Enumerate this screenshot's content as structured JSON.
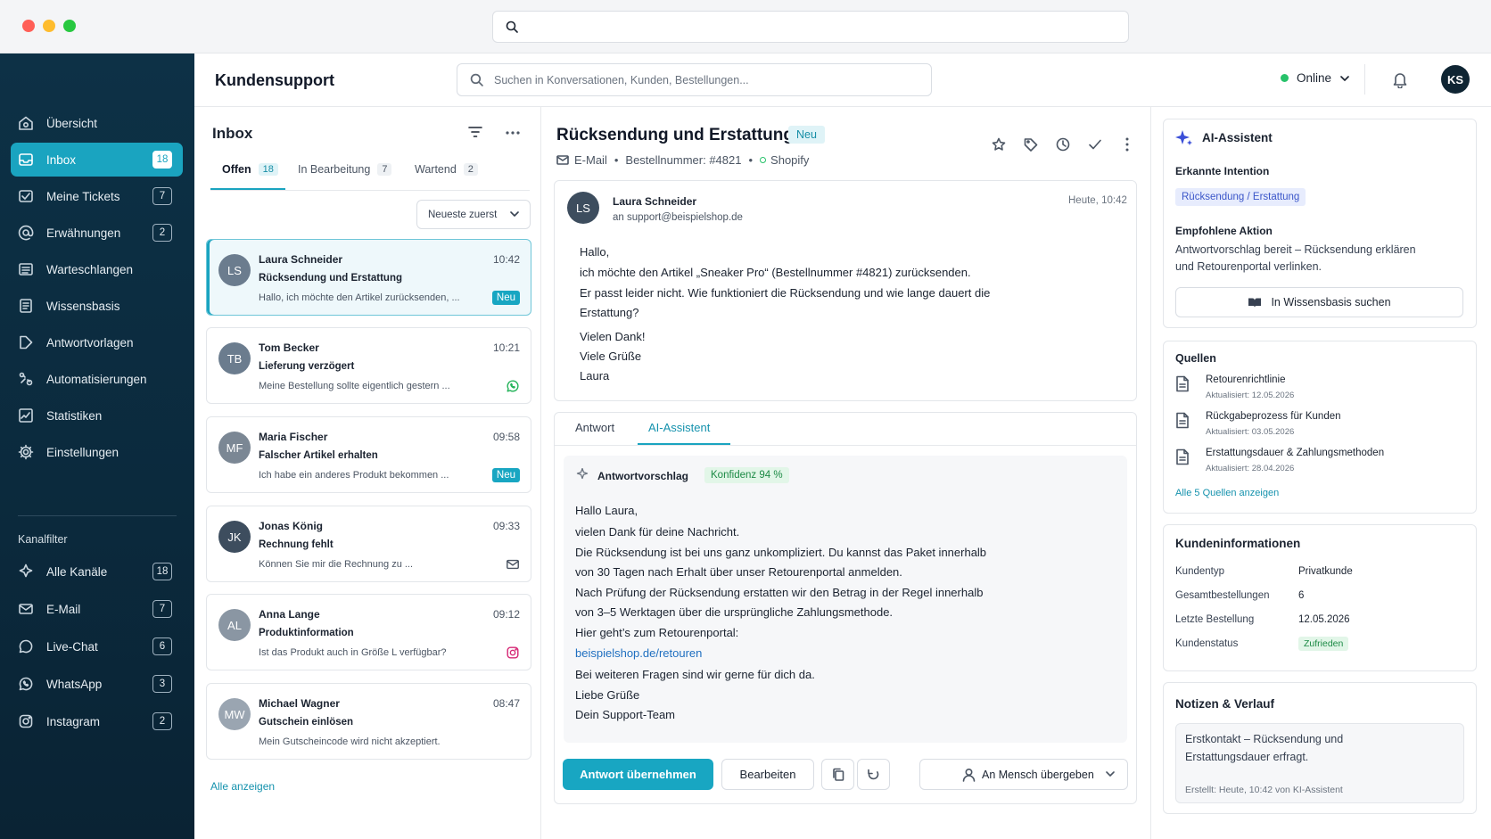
{
  "window": {
    "controls": [
      "close",
      "minimize",
      "maximize"
    ]
  },
  "colors": {
    "accent": "#18a6c2",
    "sidebar": "#0d3146",
    "online": "#27c26a",
    "ai": "#3b4fd8"
  },
  "app": {
    "title": "Kundensupport",
    "search_placeholder": "Suchen in Konversationen, Kunden, Bestellungen...",
    "status": "Online",
    "user_initials": "KS"
  },
  "nav": [
    {
      "label": "Übersicht",
      "icon": "home-icon"
    },
    {
      "label": "Inbox",
      "icon": "inbox-icon",
      "badge": "18",
      "active": true
    },
    {
      "label": "Meine Tickets",
      "icon": "ticket-icon",
      "badge": "7"
    },
    {
      "label": "Erwähnungen",
      "icon": "at-icon",
      "badge": "2"
    },
    {
      "label": "Warteschlangen",
      "icon": "queue-icon"
    },
    {
      "label": "Wissensbasis",
      "icon": "book-icon"
    },
    {
      "label": "Antwortvorlagen",
      "icon": "template-icon"
    },
    {
      "label": "Automatisierungen",
      "icon": "automation-icon"
    },
    {
      "label": "Statistiken",
      "icon": "chart-icon"
    },
    {
      "label": "Einstellungen",
      "icon": "gear-icon"
    }
  ],
  "channel_filter": {
    "heading": "Kanalfilter",
    "items": [
      {
        "label": "Alle Kanäle",
        "icon": "all-channels-icon",
        "badge": "18"
      },
      {
        "label": "E-Mail",
        "icon": "mail-icon",
        "badge": "7"
      },
      {
        "label": "Live-Chat",
        "icon": "chat-icon",
        "badge": "6"
      },
      {
        "label": "WhatsApp",
        "icon": "whatsapp-icon",
        "badge": "3"
      },
      {
        "label": "Instagram",
        "icon": "instagram-icon",
        "badge": "2"
      }
    ]
  },
  "inbox": {
    "title": "Inbox",
    "tabs": [
      {
        "label": "Offen",
        "count": "18"
      },
      {
        "label": "In Bearbeitung",
        "count": "7"
      },
      {
        "label": "Wartend",
        "count": "2"
      }
    ],
    "sort": "Neueste zuerst",
    "show_all": "Alle anzeigen",
    "conversations": [
      {
        "initials": "LS",
        "name": "Laura Schneider",
        "time": "10:42",
        "subject": "Rücksendung und Erstattung",
        "preview": "Hallo, ich möchte den Artikel zurücksenden, ...",
        "badge": "Neu",
        "channel": "",
        "avatar_color": "#6b7c8e"
      },
      {
        "initials": "TB",
        "name": "Tom Becker",
        "time": "10:21",
        "subject": "Lieferung verzögert",
        "preview": "Meine Bestellung sollte eigentlich gestern ...",
        "badge": "",
        "channel": "whatsapp-icon",
        "avatar_color": "#6b7c8e"
      },
      {
        "initials": "MF",
        "name": "Maria Fischer",
        "time": "09:58",
        "subject": "Falscher Artikel erhalten",
        "preview": "Ich habe ein anderes Produkt bekommen ...",
        "badge": "Neu",
        "channel": "",
        "avatar_color": "#7b8794"
      },
      {
        "initials": "JK",
        "name": "Jonas König",
        "time": "09:33",
        "subject": "Rechnung fehlt",
        "preview": "Können Sie mir die Rechnung zu ...",
        "badge": "",
        "channel": "mail-icon",
        "avatar_color": "#3d4d5e"
      },
      {
        "initials": "AL",
        "name": "Anna Lange",
        "time": "09:12",
        "subject": "Produktinformation",
        "preview": "Ist das Produkt auch in Größe L verfügbar?",
        "badge": "",
        "channel": "instagram-icon",
        "avatar_color": "#8a96a3"
      },
      {
        "initials": "MW",
        "name": "Michael Wagner",
        "time": "08:47",
        "subject": "Gutschein einlösen",
        "preview": "Mein Gutscheincode wird nicht akzeptiert.",
        "badge": "",
        "channel": "",
        "avatar_color": "#9aa5b1"
      }
    ]
  },
  "conversation": {
    "title": "Rücksendung und Erstattung",
    "badge": "Neu",
    "channel": "E-Mail",
    "order": "Bestellnummer: #4821",
    "shop": "Shopify",
    "actions": [
      "star-icon",
      "tag-icon",
      "clock-icon",
      "check-icon",
      "more-vertical-icon"
    ],
    "message": {
      "initials": "LS",
      "from": "Laura Schneider",
      "to": "an support@beispielshop.de",
      "time": "Heute, 10:42",
      "lines": [
        "Hallo,",
        "ich möchte den Artikel „Sneaker Pro“ (Bestellnummer #4821) zurücksenden.",
        "Er passt leider nicht. Wie funktioniert die Rücksendung und wie lange dauert die",
        "Erstattung?",
        "Vielen Dank!",
        "Viele Grüße",
        "Laura"
      ]
    },
    "reply_tabs": [
      "Antwort",
      "AI-Assistent"
    ],
    "suggestion": {
      "title": "Antwortvorschlag",
      "confidence": "Konfidenz 94 %",
      "lines": [
        "Hallo Laura,",
        "vielen Dank für deine Nachricht.",
        "Die Rücksendung ist bei uns ganz unkompliziert. Du kannst das Paket innerhalb",
        "von 30 Tagen nach Erhalt über unser Retourenportal anmelden.",
        "Nach Prüfung der Rücksendung erstatten wir den Betrag in der Regel innerhalb",
        "von 3–5 Werktagen über die ursprüngliche Zahlungsmethode.",
        "Hier geht’s zum Retourenportal:",
        "beispielshop.de/retouren",
        "Bei weiteren Fragen sind wir gerne für dich da.",
        "Liebe Grüße",
        "Dein Support-Team"
      ]
    },
    "buttons": {
      "accept": "Antwort übernehmen",
      "edit": "Bearbeiten",
      "handover": "An Mensch übergeben"
    }
  },
  "ai_panel": {
    "title": "AI-Assistent",
    "intent_heading": "Erkannte Intention",
    "intent": "Rücksendung / Erstattung",
    "action_heading": "Empfohlene Aktion",
    "action_line1": "Antwortvorschlag bereit – Rücksendung erklären",
    "action_line2": "und Retourenportal verlinken.",
    "kb_button": "In Wissensbasis suchen"
  },
  "sources": {
    "heading": "Quellen",
    "items": [
      {
        "title": "Retourenrichtlinie",
        "updated": "Aktualisiert: 12.05.2026"
      },
      {
        "title": "Rückgabeprozess für Kunden",
        "updated": "Aktualisiert: 03.05.2026"
      },
      {
        "title": "Erstattungsdauer & Zahlungsmethoden",
        "updated": "Aktualisiert: 28.04.2026"
      }
    ],
    "show_all": "Alle 5 Quellen anzeigen"
  },
  "customer": {
    "heading": "Kundeninformationen",
    "rows": [
      {
        "label": "Kundentyp",
        "value": "Privatkunde"
      },
      {
        "label": "Gesamtbestellungen",
        "value": "6"
      },
      {
        "label": "Letzte Bestellung",
        "value": "12.05.2026"
      },
      {
        "label": "Kundenstatus",
        "value": "Zufrieden"
      }
    ]
  },
  "notes": {
    "heading": "Notizen & Verlauf",
    "line1": "Erstkontakt – Rücksendung und",
    "line2": "Erstattungsdauer erfragt.",
    "meta": "Erstellt: Heute, 10:42 von KI-Assistent"
  }
}
